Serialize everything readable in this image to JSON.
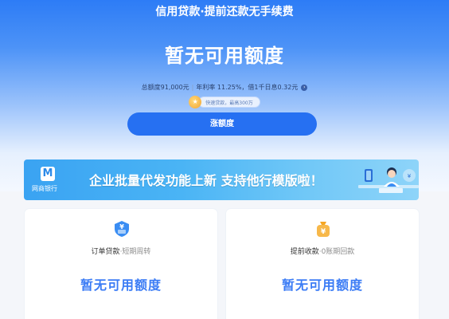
{
  "header": {
    "title": "信用贷款·提前还款无手续费"
  },
  "credit": {
    "status": "暂无可用额度",
    "info_total": "总额度91,000元",
    "info_rate": "年利率 11.25%，借1千日息0.32元",
    "tag": "快速贷款，最高300万",
    "raise_button": "涨额度"
  },
  "banner": {
    "logo_mark": "M",
    "logo_text": "网商银行",
    "headline": "企业批量代发功能上新 支持他行模版啦！"
  },
  "cards": [
    {
      "title": "订单贷款",
      "subtitle": "·短期周转",
      "status": "暂无可用额度",
      "icon": "shield-yuan-icon",
      "icon_color": "#3a8df3"
    },
    {
      "title": "提前收款",
      "subtitle": "·0账期回款",
      "status": "暂无可用额度",
      "icon": "yuan-bag-icon",
      "icon_color": "#f5a623"
    }
  ],
  "colors": {
    "primary": "#2670f2",
    "amount": "#3b7cf5"
  }
}
